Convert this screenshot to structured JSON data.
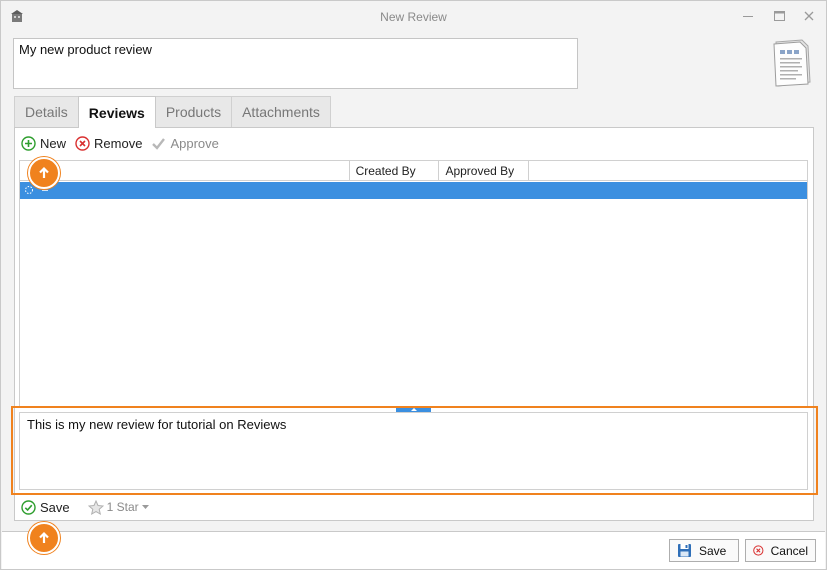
{
  "window": {
    "title": "New Review"
  },
  "title_input": {
    "value": "My new product review"
  },
  "tabs": [
    {
      "label": "Details",
      "active": false
    },
    {
      "label": "Reviews",
      "active": true
    },
    {
      "label": "Products",
      "active": false
    },
    {
      "label": "Attachments",
      "active": false
    }
  ],
  "toolbar": {
    "new_label": "New",
    "remove_label": "Remove",
    "approve_label": "Approve"
  },
  "grid": {
    "columns": [
      "",
      "Created By",
      "Approved By",
      ""
    ],
    "selected_row_color": "#3b8fe0"
  },
  "description": {
    "text": "This is my new review for tutorial on Reviews"
  },
  "bottom_toolbar": {
    "save_label": "Save",
    "rating_label": "1 Star"
  },
  "footer": {
    "save_label": "Save",
    "cancel_label": "Cancel"
  },
  "colors": {
    "accent": "#3b8fe0",
    "highlight": "#f0821e",
    "success": "#2e9e2e",
    "danger": "#d93030"
  }
}
